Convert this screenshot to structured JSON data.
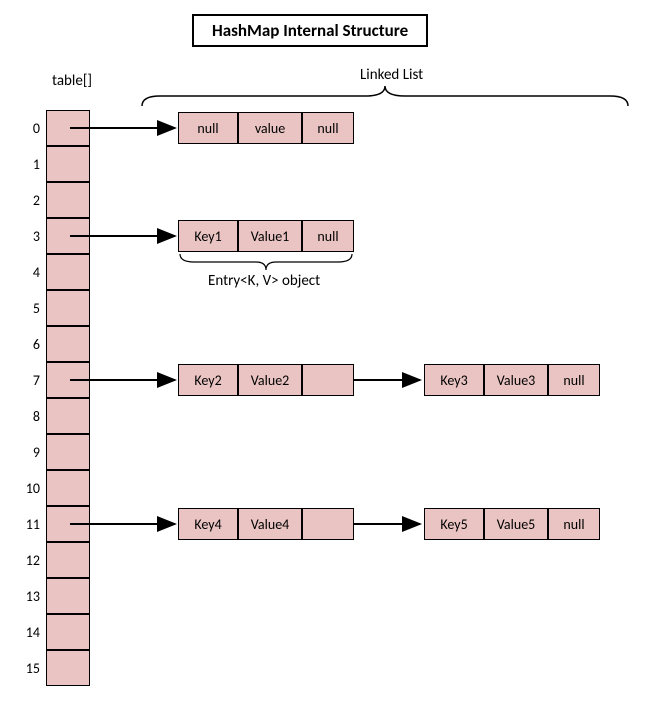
{
  "title": "HashMap Internal Structure",
  "labels": {
    "table_header": "table[]",
    "linked_list": "Linked List",
    "entry_object": "Entry<K, V> object"
  },
  "bucket_count": 16,
  "buckets": [
    {
      "index": 0
    },
    {
      "index": 1
    },
    {
      "index": 2
    },
    {
      "index": 3
    },
    {
      "index": 4
    },
    {
      "index": 5
    },
    {
      "index": 6
    },
    {
      "index": 7
    },
    {
      "index": 8
    },
    {
      "index": 9
    },
    {
      "index": 10
    },
    {
      "index": 11
    },
    {
      "index": 12
    },
    {
      "index": 13
    },
    {
      "index": 14
    },
    {
      "index": 15
    }
  ],
  "rows": {
    "0": [
      {
        "key": "null",
        "value": "value",
        "next": "null"
      }
    ],
    "3": [
      {
        "key": "Key1",
        "value": "Value1",
        "next": "null"
      }
    ],
    "7": [
      {
        "key": "Key2",
        "value": "Value2",
        "next": "->"
      },
      {
        "key": "Key3",
        "value": "Value3",
        "next": "null"
      }
    ],
    "11": [
      {
        "key": "Key4",
        "value": "Value4",
        "next": "->"
      },
      {
        "key": "Key5",
        "value": "Value5",
        "next": "null"
      }
    ]
  },
  "colors": {
    "cell_fill": "#E9C4C2",
    "border": "#000000"
  }
}
